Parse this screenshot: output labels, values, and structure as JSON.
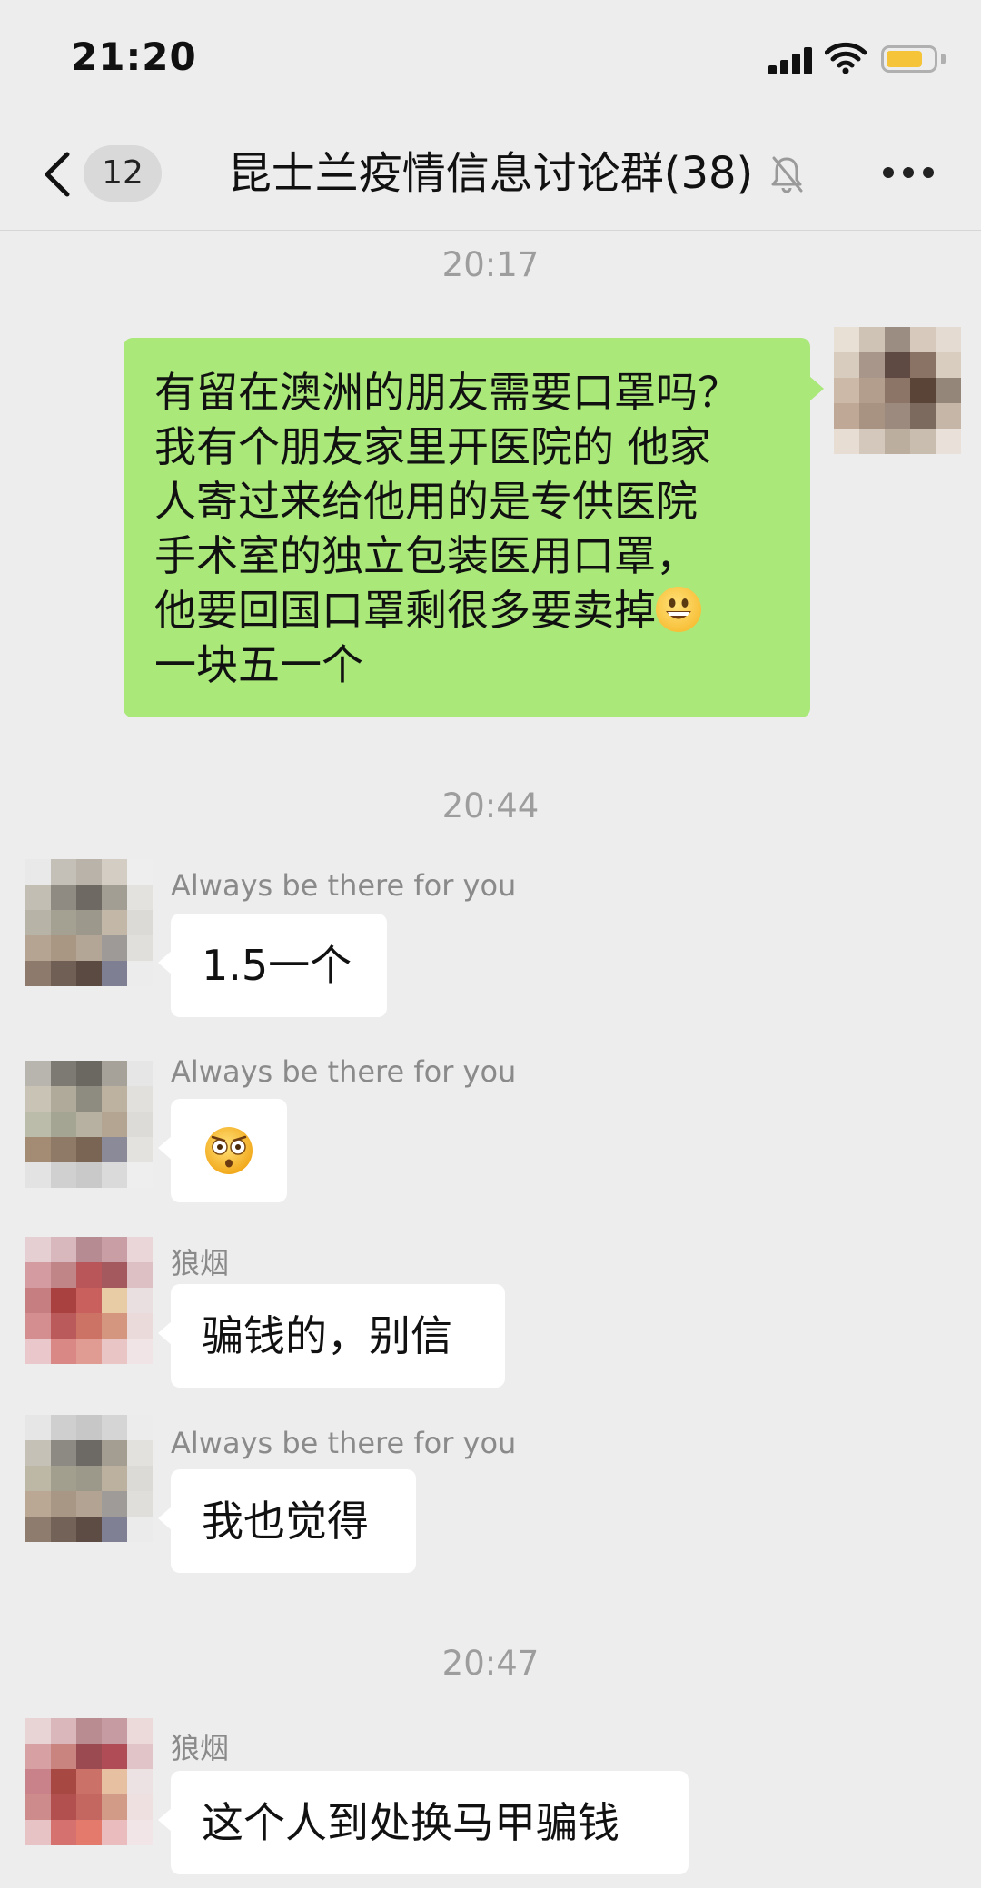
{
  "status_bar": {
    "time": "21:20"
  },
  "nav": {
    "unread_count": "12",
    "title": "昆士兰疫情信息讨论群(38)",
    "icons": {
      "back": "chevron-left-icon",
      "mute": "bell-slash-icon",
      "more": "more-dots-icon"
    }
  },
  "messages": [
    {
      "type": "time",
      "text": "20:17"
    },
    {
      "type": "message",
      "direction": "outgoing",
      "lines": [
        "有留在澳洲的朋友需要口罩吗？",
        "我有个朋友家里开医院的 他家",
        "人寄过来给他用的是专供医院",
        "手术室的独立包装医用口罩，",
        "他要回国口罩剩很多要卖掉",
        "一块五一个"
      ],
      "emoji": "grinning-face-emoji"
    },
    {
      "type": "time",
      "text": "20:44"
    },
    {
      "type": "message",
      "direction": "incoming",
      "sender": "Always be there for you",
      "text": "1.5一个"
    },
    {
      "type": "message",
      "direction": "incoming",
      "sender": "Always be there for you",
      "emoji": "flushed-face-emoji"
    },
    {
      "type": "message",
      "direction": "incoming",
      "sender": "狼烟",
      "text": "骗钱的，别信"
    },
    {
      "type": "message",
      "direction": "incoming",
      "sender": "Always be there for you",
      "text": "我也觉得"
    },
    {
      "type": "time",
      "text": "20:47"
    },
    {
      "type": "message",
      "direction": "incoming",
      "sender": "狼烟",
      "text": "这个人到处换马甲骗钱"
    }
  ],
  "colors": {
    "background": "#ededed",
    "outgoing_bubble": "#a9e879",
    "incoming_bubble": "#ffffff",
    "timestamp_text": "#9d9d9d",
    "battery": "#f5c438"
  }
}
